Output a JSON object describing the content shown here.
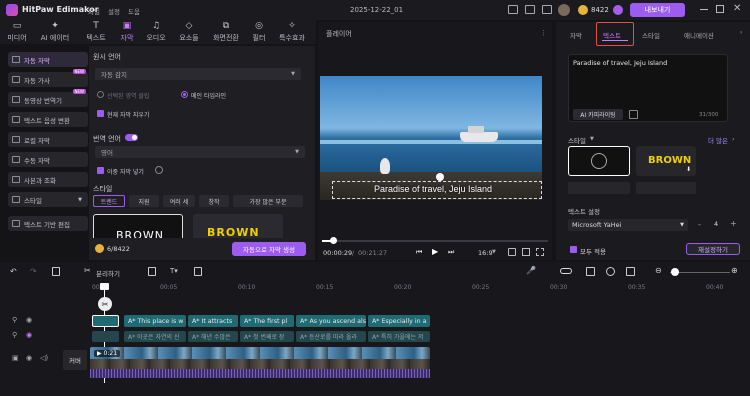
{
  "app": {
    "name": "HitPaw Edimakor",
    "menu": [
      "파일",
      "설정",
      "도움"
    ],
    "project_title": "2025-12-22_01",
    "credits": "8422",
    "export_label": "내보내기"
  },
  "toolbar": {
    "tools": [
      {
        "label": "미디어",
        "icon": "media-icon"
      },
      {
        "label": "AI 에이터",
        "icon": "ai-icon"
      },
      {
        "label": "텍스트",
        "icon": "text-icon"
      },
      {
        "label": "자막",
        "icon": "subtitle-icon"
      },
      {
        "label": "오디오",
        "icon": "audio-icon"
      },
      {
        "label": "요소들",
        "icon": "elements-icon"
      },
      {
        "label": "화면전환",
        "icon": "transition-icon"
      },
      {
        "label": "필터",
        "icon": "filter-icon"
      },
      {
        "label": "특수효과",
        "icon": "effects-icon"
      }
    ]
  },
  "sidebar": {
    "items": [
      {
        "label": "자동 자막",
        "active": true
      },
      {
        "label": "자동 가사",
        "badge": "NEW"
      },
      {
        "label": "동영상 번역기",
        "badge": "NEW"
      },
      {
        "label": "텍스트 음성 변환"
      },
      {
        "label": "로컬 자막"
      },
      {
        "label": "수동 자막"
      },
      {
        "label": "사본과 조화"
      },
      {
        "label": "스타일"
      },
      {
        "label": "텍스트 기반 편집"
      }
    ]
  },
  "panel": {
    "voice_lang_label": "원시 언어",
    "voice_lang_value": "자동 감지",
    "radio1": "선택된 영역 클립",
    "radio2": "메인 타임라인",
    "chk_clear": "현재 자막 지우기",
    "trans_label": "번역 언어",
    "trans_value": "영어",
    "chk_dual": "이중 자막 넣기",
    "style_label": "스타일",
    "style_tabs": [
      "트렌드",
      "지원",
      "여러 세",
      "창작",
      "가장 많은 부분"
    ],
    "style_sample1": "BROWN",
    "style_sample2": "BROWN",
    "credits": "6/8422",
    "generate_label": "자동으로 자막 생성"
  },
  "preview": {
    "header": "플레이어",
    "subtitle": "Paradise of travel, Jeju Island",
    "time_current": "00:00:29",
    "time_total": "00:21:27",
    "aspect": "16:9"
  },
  "right": {
    "tabs": [
      "자막",
      "텍스트",
      "스타일",
      "애니메이션"
    ],
    "text_value": "Paradise of travel, Jeju Island",
    "ai_write": "AI 카피라이팅",
    "char_count": "31/300",
    "style_label": "스타일",
    "more_label": "더 많은",
    "style_preset": "BROWN",
    "text_settings": "텍스트 설정",
    "font": "Microsoft YaHei",
    "font_size": "4",
    "apply_all": "모두 적용",
    "reset": "재설정하기"
  },
  "timeline": {
    "split_label": "분리하기",
    "ticks": [
      "00:00",
      "00:05",
      "00:10",
      "00:15",
      "00:20",
      "00:25",
      "00:30",
      "00:35",
      "00:40"
    ],
    "track_label": "커버",
    "video_dur": "0:21",
    "sub_clips": [
      "A* This place is w",
      "A* It attracts",
      "A* The first pl",
      "A* As you ascend als",
      "A* Especially in a"
    ],
    "trans_clips": [
      "A* 이곳은 자연의 신",
      "A* 해년 수많은",
      "A* 첫 번째로 장",
      "A* 등산로를 따라 올라",
      "A* 특히 가을에는 저"
    ]
  },
  "colors": {
    "accent": "#9d5cf0",
    "teal": "#1f6b73"
  }
}
